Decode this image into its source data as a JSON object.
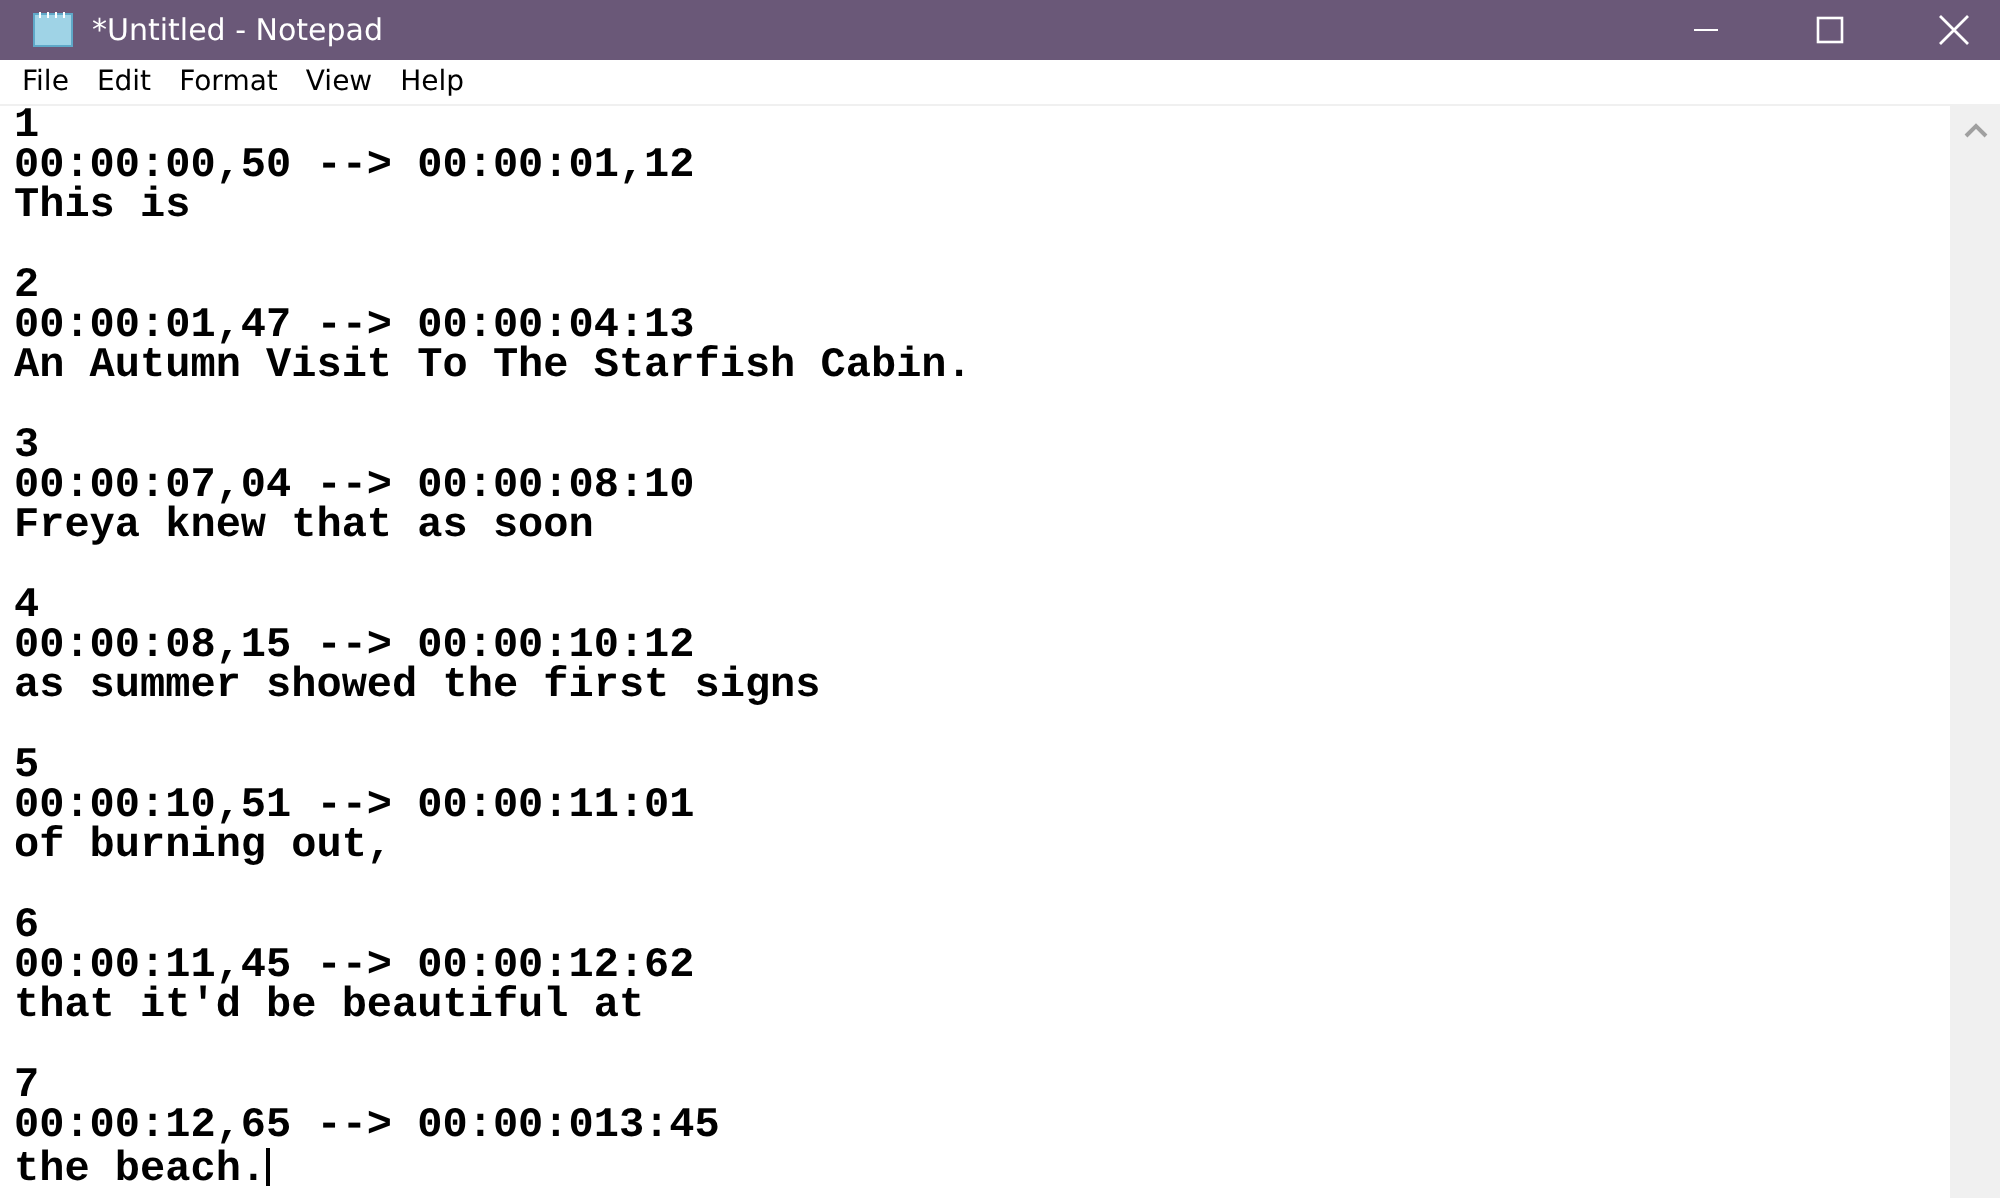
{
  "window": {
    "title": "*Untitled - Notepad"
  },
  "menu": [
    "File",
    "Edit",
    "Format",
    "View",
    "Help"
  ],
  "entries": [
    {
      "index": "1",
      "timing": "00:00:00,50 --> 00:00:01,12",
      "text": "This is"
    },
    {
      "index": "2",
      "timing": "00:00:01,47 --> 00:00:04:13",
      "text": "An Autumn Visit To The Starfish Cabin."
    },
    {
      "index": "3",
      "timing": "00:00:07,04 --> 00:00:08:10",
      "text": "Freya knew that as soon"
    },
    {
      "index": "4",
      "timing": "00:00:08,15 --> 00:00:10:12",
      "text": "as summer showed the first signs"
    },
    {
      "index": "5",
      "timing": "00:00:10,51 --> 00:00:11:01",
      "text": "of burning out,"
    },
    {
      "index": "6",
      "timing": "00:00:11,45 --> 00:00:12:62",
      "text": "that it'd be beautiful at"
    },
    {
      "index": "7",
      "timing": "00:00:12,65 --> 00:00:013:45",
      "text": "the beach."
    }
  ]
}
